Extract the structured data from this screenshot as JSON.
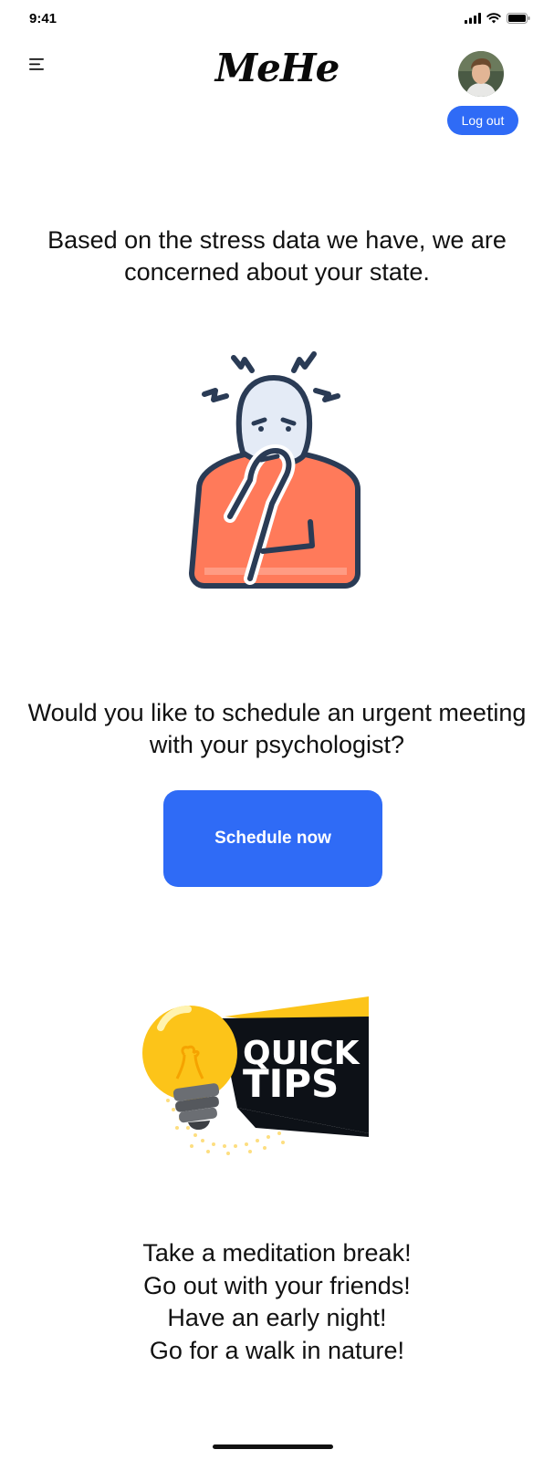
{
  "status_bar": {
    "time": "9:41"
  },
  "header": {
    "logo": "MeHe",
    "logout_label": "Log out"
  },
  "concern_message": "Based on the stress data we have, we are concerned about your state.",
  "schedule_prompt": "Would you like to schedule an urgent meeting with your psychologist?",
  "schedule_button_label": "Schedule now",
  "tips_graphic": {
    "line1": "QUICK",
    "line2": "TIPS"
  },
  "tips": [
    "Take a meditation break!",
    "Go out with your friends!",
    "Have an early night!",
    "Go for a walk in nature!"
  ],
  "colors": {
    "accent": "#2f6bf6",
    "illustration_shirt": "#ff7a5a",
    "illustration_outline": "#2a3b55",
    "bulb_yellow": "#fcc419"
  },
  "icons": {
    "menu": "hamburger-menu-icon",
    "signal": "signal-icon",
    "wifi": "wifi-icon",
    "battery": "battery-icon"
  }
}
